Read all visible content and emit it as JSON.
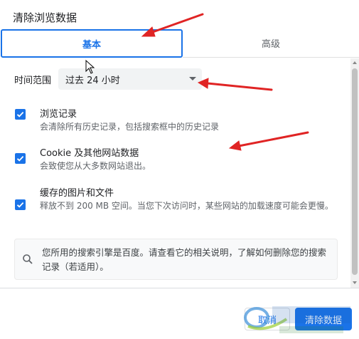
{
  "dialog": {
    "title": "清除浏览数据",
    "tabs": [
      {
        "label": "基本",
        "active": true
      },
      {
        "label": "高级",
        "active": false
      }
    ],
    "time_range": {
      "label": "时间范围",
      "selected": "过去 24 小时"
    },
    "options": [
      {
        "title": "浏览记录",
        "desc": "会清除所有历史记录，包括搜索框中的历史记录",
        "checked": true
      },
      {
        "title": "Cookie 及其他网站数据",
        "desc": "会致使您从大多数网站退出。",
        "checked": true
      },
      {
        "title": "缓存的图片和文件",
        "desc": "释放不到 200 MB 空间。当您下次访问时，某些网站的加载速度可能会更慢。",
        "checked": true
      }
    ],
    "info": {
      "icon": "search-icon",
      "text": "您所用的搜索引擎是百度。请查看它的相关说明，了解如何删除您的搜索记录（若适用）。"
    },
    "buttons": {
      "cancel": "取消",
      "clear": "清除数据"
    }
  },
  "colors": {
    "accent": "#1a73e8",
    "annotation_arrow": "#e02424"
  }
}
